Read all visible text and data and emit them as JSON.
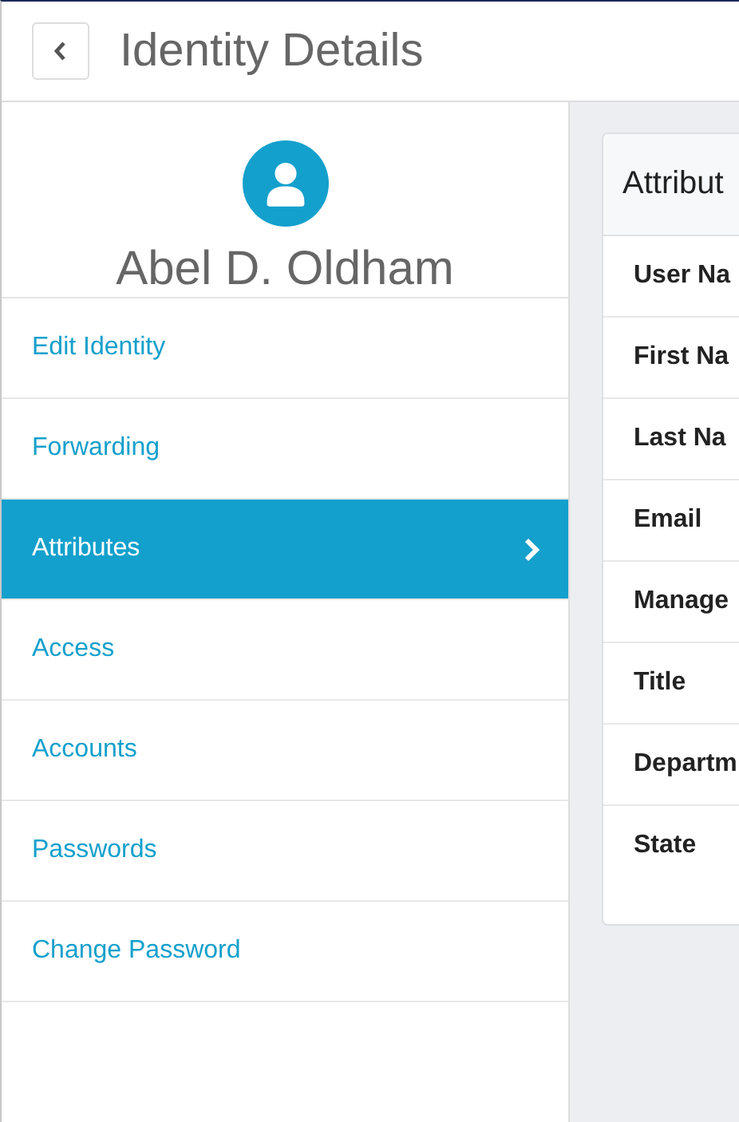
{
  "header": {
    "title": "Identity Details"
  },
  "profile": {
    "name": "Abel D. Oldham"
  },
  "menu": [
    {
      "label": "Edit Identity",
      "selected": false
    },
    {
      "label": "Forwarding",
      "selected": false
    },
    {
      "label": "Attributes",
      "selected": true
    },
    {
      "label": "Access",
      "selected": false
    },
    {
      "label": "Accounts",
      "selected": false
    },
    {
      "label": "Passwords",
      "selected": false
    },
    {
      "label": "Change Password",
      "selected": false
    }
  ],
  "card": {
    "title": "Attribut",
    "rows": [
      "User Na",
      "First Na",
      "Last Na",
      "Email",
      "Manage",
      "Title",
      "Departm",
      "State"
    ]
  }
}
